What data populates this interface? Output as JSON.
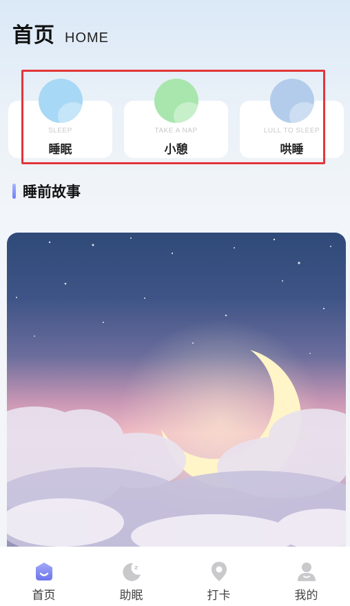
{
  "header": {
    "title": "首页",
    "subtitle": "HOME"
  },
  "modes": [
    {
      "en": "SLEEP",
      "cn": "睡眠",
      "color": "#a7d8f5"
    },
    {
      "en": "TAKE A NAP",
      "cn": "小憩",
      "color": "#a8e6ae"
    },
    {
      "en": "LULL TO SLEEP",
      "cn": "哄睡",
      "color": "#b3ccec"
    }
  ],
  "section": {
    "title": "睡前故事"
  },
  "tabs": [
    {
      "label": "首页",
      "icon": "home-icon",
      "active": true
    },
    {
      "label": "助眠",
      "icon": "moon-icon",
      "active": false
    },
    {
      "label": "打卡",
      "icon": "location-pin-icon",
      "active": false
    },
    {
      "label": "我的",
      "icon": "user-icon",
      "active": false
    }
  ],
  "colors": {
    "accent": "#7b86ef",
    "highlight": "#e2353a"
  }
}
